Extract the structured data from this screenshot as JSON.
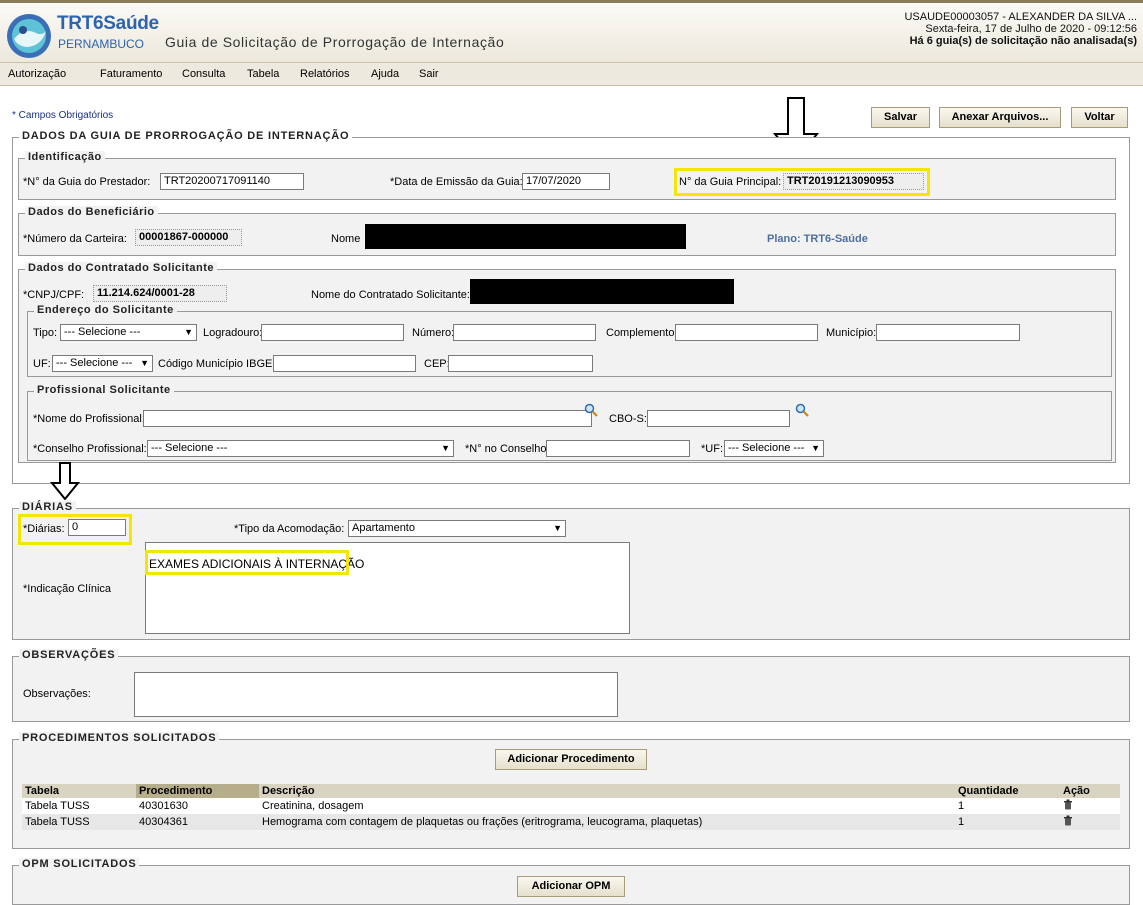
{
  "header": {
    "brand_name": "TRT6Saúde",
    "brand_sub": "PERNAMBUCO",
    "page_title": "Guia de Solicitação de Prorrogação de Internação",
    "user_line": "USAUDE00003057 - ALEXANDER DA SILVA ...",
    "date_line": "Sexta-feira, 17 de Julho de 2020 - 09:12:56",
    "pending_line": "Há 6 guia(s) de solicitação não analisada(s)"
  },
  "menu": [
    "Autorização",
    "Faturamento",
    "Consulta",
    "Tabela",
    "Relatórios",
    "Ajuda",
    "Sair"
  ],
  "required_note": "* Campos Obrigatórios",
  "actions": {
    "save": "Salvar",
    "attach": "Anexar Arquivos...",
    "back": "Voltar"
  },
  "dados_guia": {
    "legend": "DADOS DA GUIA DE PRORROGAÇÃO DE INTERNAÇÃO",
    "identificacao": {
      "legend": "Identificação",
      "n_guia_prestador_label": "*N° da Guia do Prestador:",
      "n_guia_prestador_value": "TRT20200717091140",
      "data_emissao_label": "*Data de Emissão da Guia:",
      "data_emissao_value": "17/07/2020",
      "guia_principal_label": "N° da Guia Principal:",
      "guia_principal_value": "TRT20191213090953"
    },
    "beneficiario": {
      "legend": "Dados do Beneficiário",
      "carteira_label": "*Número da Carteira:",
      "carteira_value": "00001867-000000",
      "nome_label": "Nome",
      "plano_label": "Plano: TRT6-Saúde"
    },
    "contratado": {
      "legend": "Dados do Contratado Solicitante",
      "cnpj_label": "*CNPJ/CPF:",
      "cnpj_value": "11.214.624/0001-28",
      "nome_label": "Nome do Contratado Solicitante:"
    },
    "endereco": {
      "legend": "Endereço do Solicitante",
      "tipo_label": "Tipo:",
      "tipo_value": "--- Selecione ---",
      "logradouro_label": "Logradouro:",
      "numero_label": "Número:",
      "complemento_label": "Complemento:",
      "municipio_label": "Município:",
      "uf_label": "UF:",
      "uf_value": "--- Selecione ---",
      "ibge_label": "Código Município IBGE:",
      "cep_label": "CEP:"
    },
    "profissional": {
      "legend": "Profissional Solicitante",
      "nome_label": "*Nome do Profissional:",
      "cbo_label": "CBO-S:",
      "conselho_label": "*Conselho Profissional:",
      "conselho_value": "--- Selecione ---",
      "n_conselho_label": "*N° no Conselho:",
      "uf_label": "*UF:",
      "uf_value": "--- Selecione ---"
    }
  },
  "diarias": {
    "legend": "DIÁRIAS",
    "diarias_label": "*Diárias:",
    "diarias_value": "0",
    "acomodacao_label": "*Tipo da Acomodação:",
    "acomodacao_value": "Apartamento",
    "indicacao_label": "*Indicação Clínica",
    "indicacao_value": "EXAMES ADICIONAIS À INTERNAÇÃO"
  },
  "observacoes": {
    "legend": "OBSERVAÇÕES",
    "label": "Observações:"
  },
  "procedimentos": {
    "legend": "PROCEDIMENTOS SOLICITADOS",
    "add_button": "Adicionar Procedimento",
    "columns": [
      "Tabela",
      "Procedimento",
      "Descrição",
      "Quantidade",
      "Ação"
    ],
    "rows": [
      {
        "tabela": "Tabela TUSS",
        "procedimento": "40301630",
        "descricao": "Creatinina, dosagem",
        "quantidade": "1"
      },
      {
        "tabela": "Tabela TUSS",
        "procedimento": "40304361",
        "descricao": "Hemograma com contagem de plaquetas ou frações (eritrograma, leucograma, plaquetas)",
        "quantidade": "1"
      }
    ]
  },
  "opm": {
    "legend": "OPM SOLICITADOS",
    "add_button": "Adicionar OPM"
  },
  "colors": {
    "highlight": "#f3e600",
    "brand_blue": "#2f63ad",
    "table_header": "#d9d3c1"
  }
}
